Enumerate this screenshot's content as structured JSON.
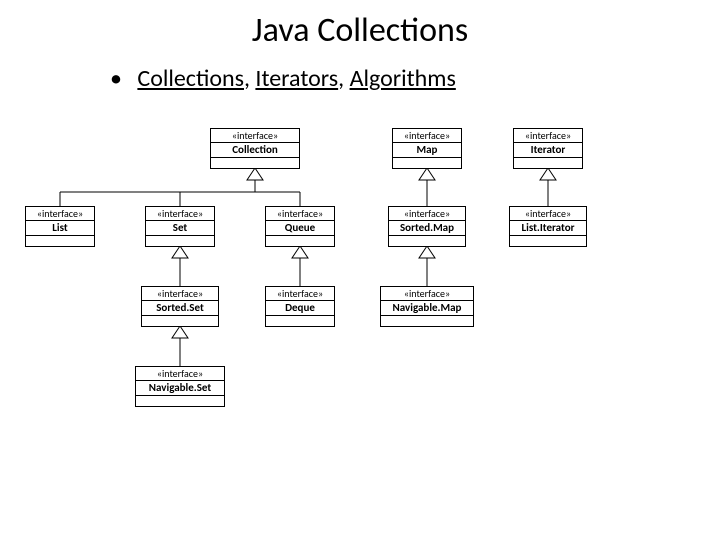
{
  "title": "Java Collections",
  "bullet": {
    "collections": "Collections",
    "sep1": ", ",
    "iterators": "Iterators",
    "sep2": ", ",
    "algorithms": "Algorithms"
  },
  "stereotype": "«interface»",
  "boxes": {
    "collection": "Collection",
    "map": "Map",
    "iterator": "Iterator",
    "list": "List",
    "set": "Set",
    "queue": "Queue",
    "sortedmap": "Sorted.Map",
    "listiterator": "List.Iterator",
    "sortedset": "Sorted.Set",
    "deque": "Deque",
    "navigablemap": "Navigable.Map",
    "navigableset": "Navigable.Set"
  }
}
